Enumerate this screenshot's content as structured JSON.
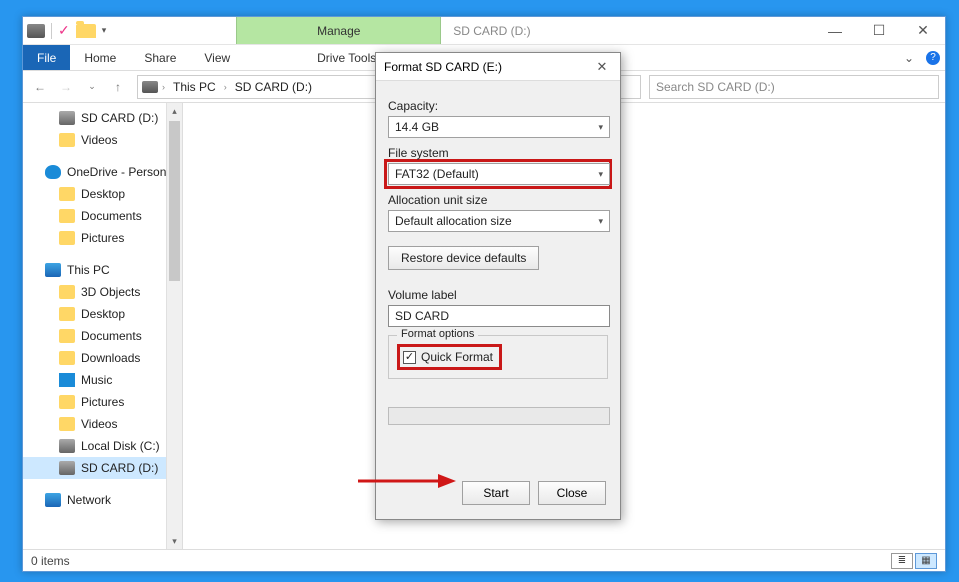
{
  "titlebar": {
    "manage": "Manage",
    "title": "SD CARD (D:)"
  },
  "ribbon": {
    "file": "File",
    "home": "Home",
    "share": "Share",
    "view": "View",
    "drivetools": "Drive Tools"
  },
  "nav": {
    "crumb1": "This PC",
    "crumb2": "SD CARD (D:)",
    "search_placeholder": "Search SD CARD (D:)"
  },
  "tree": {
    "sdcard": "SD CARD (D:)",
    "videos": "Videos",
    "onedrive": "OneDrive - Person",
    "desktop": "Desktop",
    "documents": "Documents",
    "pictures": "Pictures",
    "thispc": "This PC",
    "obj3d": "3D Objects",
    "desktop2": "Desktop",
    "documents2": "Documents",
    "downloads": "Downloads",
    "music": "Music",
    "pictures2": "Pictures",
    "videos2": "Videos",
    "localdisk": "Local Disk (C:)",
    "sdcard2": "SD CARD (D:)",
    "network": "Network"
  },
  "status": {
    "items": "0 items"
  },
  "dialog": {
    "title": "Format SD CARD (E:)",
    "capacity_label": "Capacity:",
    "capacity_value": "14.4 GB",
    "fs_label": "File system",
    "fs_value": "FAT32 (Default)",
    "alloc_label": "Allocation unit size",
    "alloc_value": "Default allocation size",
    "restore": "Restore device defaults",
    "vol_label": "Volume label",
    "vol_value": "SD CARD",
    "fopts": "Format options",
    "quick": "Quick Format",
    "start": "Start",
    "close": "Close"
  }
}
